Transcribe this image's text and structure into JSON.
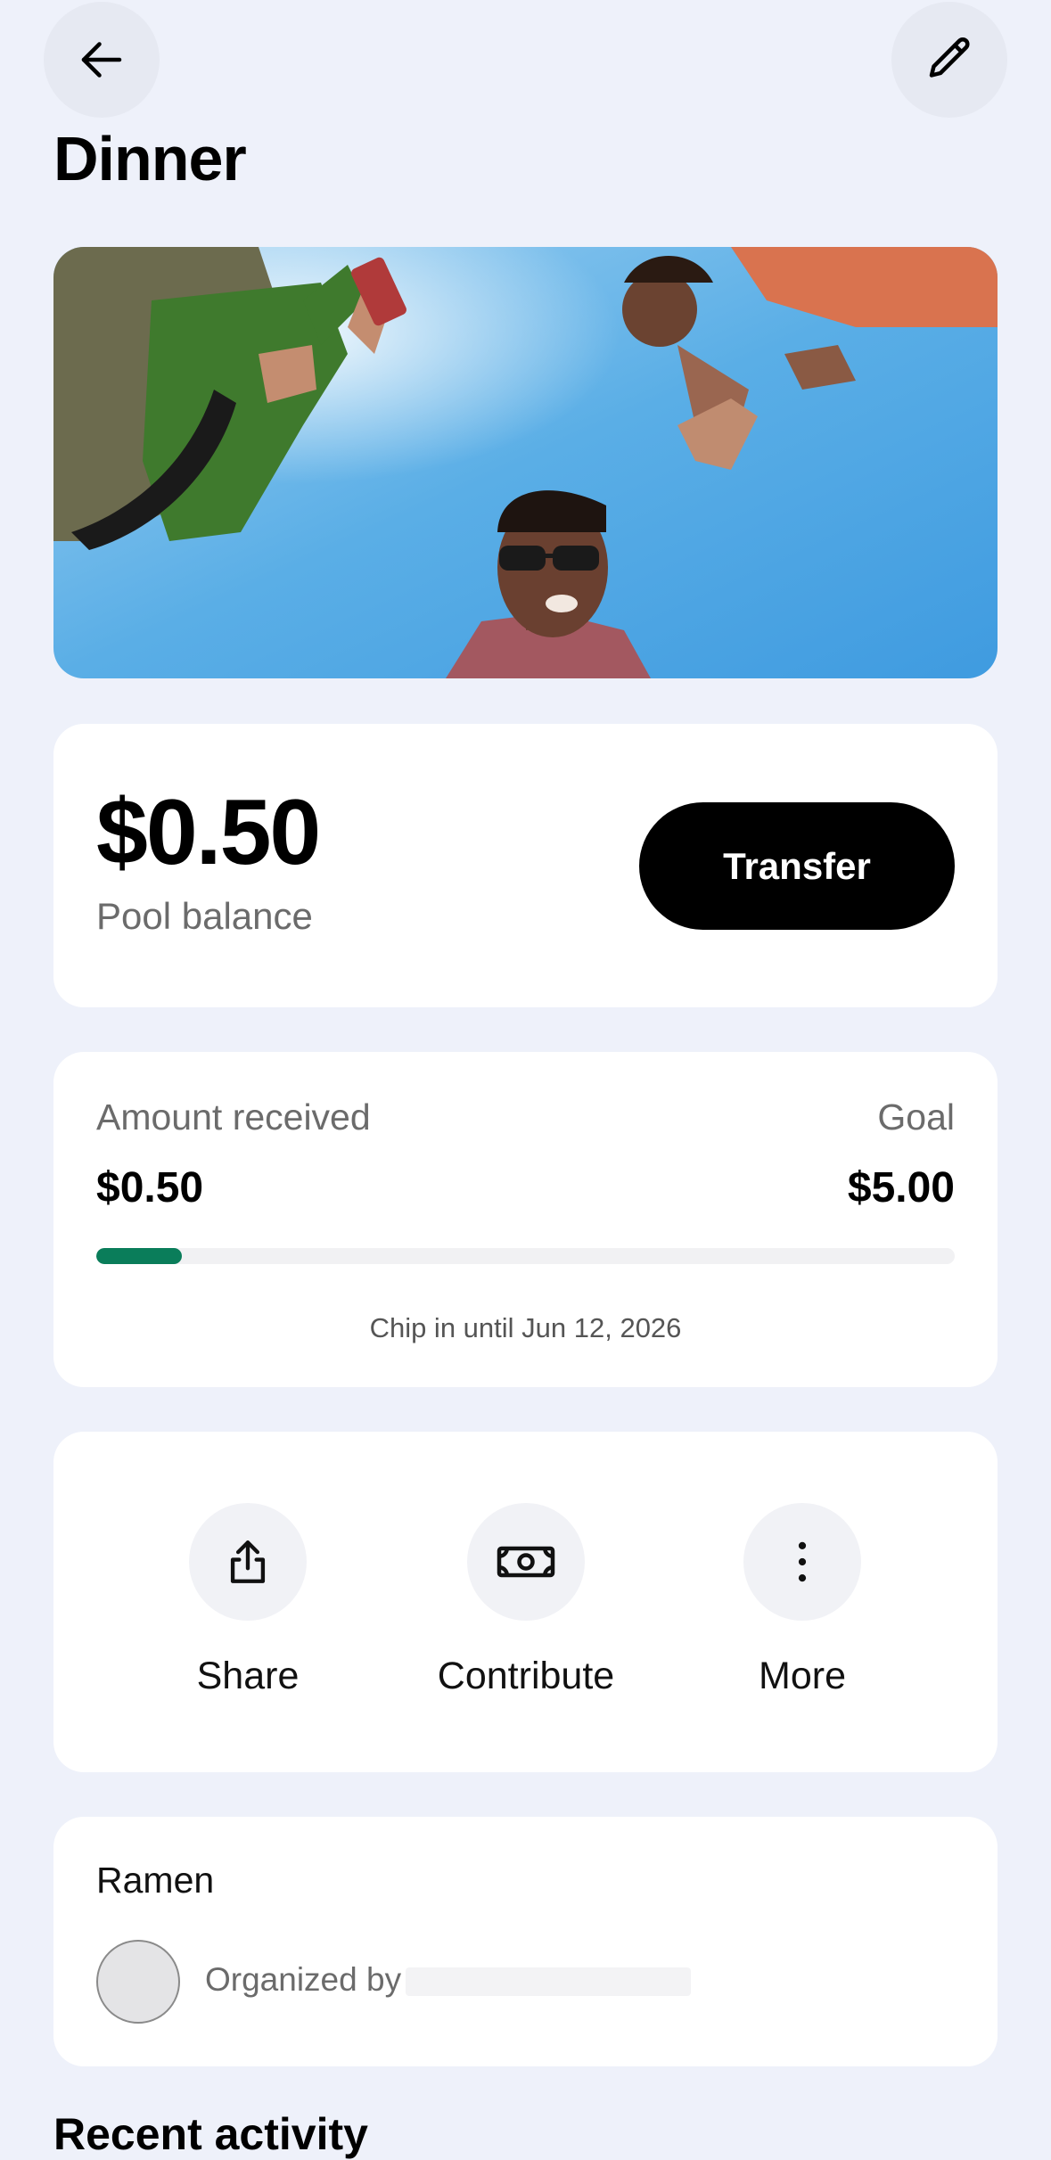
{
  "header": {
    "title": "Dinner",
    "back_icon": "arrow-left-icon",
    "edit_icon": "pencil-icon"
  },
  "hero": {
    "description_icon": "group-photo-image",
    "sky_color": "#5aaee6"
  },
  "balance": {
    "amount": "$0.50",
    "label": "Pool balance",
    "transfer_label": "Transfer"
  },
  "goal": {
    "received_label": "Amount received",
    "received_value": "$0.50",
    "goal_label": "Goal",
    "goal_value": "$5.00",
    "progress_fraction": 0.1,
    "progress_color": "#0a7d5a",
    "deadline_text": "Chip in until Jun 12, 2026"
  },
  "actions": [
    {
      "label": "Share",
      "icon": "share-icon"
    },
    {
      "label": "Contribute",
      "icon": "cash-icon"
    },
    {
      "label": "More",
      "icon": "more-vertical-icon"
    }
  ],
  "organizer": {
    "pool_name": "Ramen",
    "organized_by_label": "Organized by"
  },
  "recent_activity": {
    "heading": "Recent activity"
  }
}
